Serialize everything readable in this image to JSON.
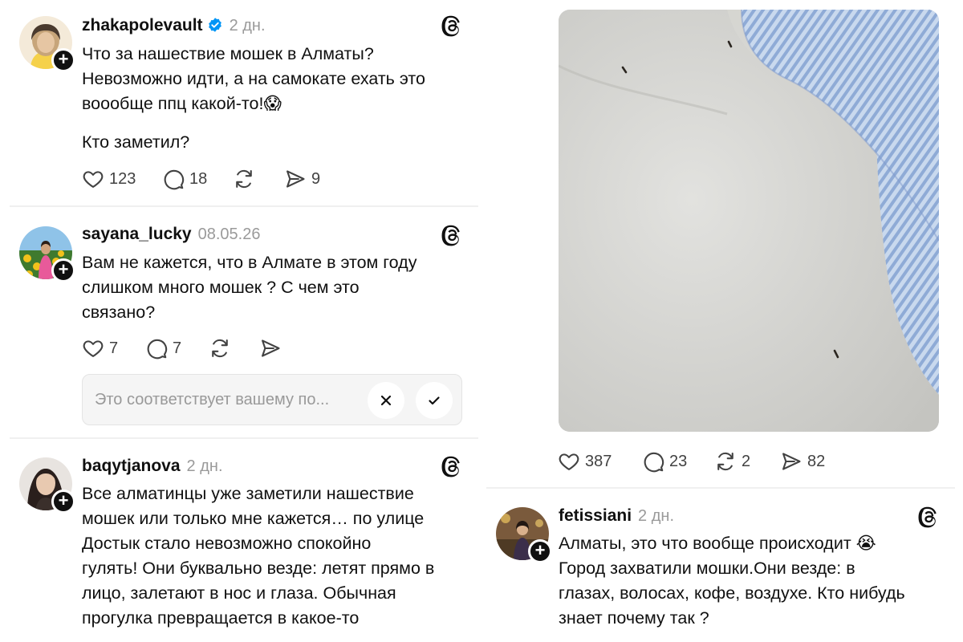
{
  "posts": [
    {
      "username": "zhakapolevault",
      "time": "2 дн.",
      "verified": true,
      "text": [
        "Что за нашествие мошек в Алматы?",
        "Невозможно идти, а на самокате ехать это",
        "воообще ппц какой-то!😱",
        "Кто заметил?"
      ],
      "likes": "123",
      "comments": "18",
      "reposts": "",
      "shares": "9"
    },
    {
      "username": "sayana_lucky",
      "time": "08.05.26",
      "text": [
        "Вам не кажется, что в Алмате в этом году",
        "слишком много мошек ? С чем это",
        "связано?"
      ],
      "likes": "7",
      "comments": "7",
      "reposts": "",
      "shares": ""
    },
    {
      "username": "baqytjanova",
      "time": "2 дн.",
      "text": [
        "Все алматинцы уже заметили нашествие",
        "мошек или только мне кажется…  по улице",
        "Достык стало невозможно спокойно",
        "гулять! Они буквально везде: летят прямо в",
        "лицо, залетают в нос и глаза. Обычная",
        "прогулка превращается в какое-то"
      ]
    },
    {
      "likes": "387",
      "comments": "23",
      "reposts": "2",
      "shares": "82"
    },
    {
      "username": "fetissiani",
      "time": "2 дн.",
      "text": [
        "Алматы, это что вообще происходит 😭",
        "Город захватили мошки.Они везде: в",
        "глазах, волосах, кофе, воздухе. Кто нибудь",
        "знает почему так ?"
      ]
    }
  ],
  "feedback": {
    "placeholder": "Это соответствует вашему по...",
    "dismiss_icon": "close-icon",
    "confirm_icon": "check-icon"
  },
  "colors": {
    "text": "#101010",
    "muted": "#9a9a9a",
    "verified": "#0095f6",
    "divider": "#f0f0f0"
  }
}
